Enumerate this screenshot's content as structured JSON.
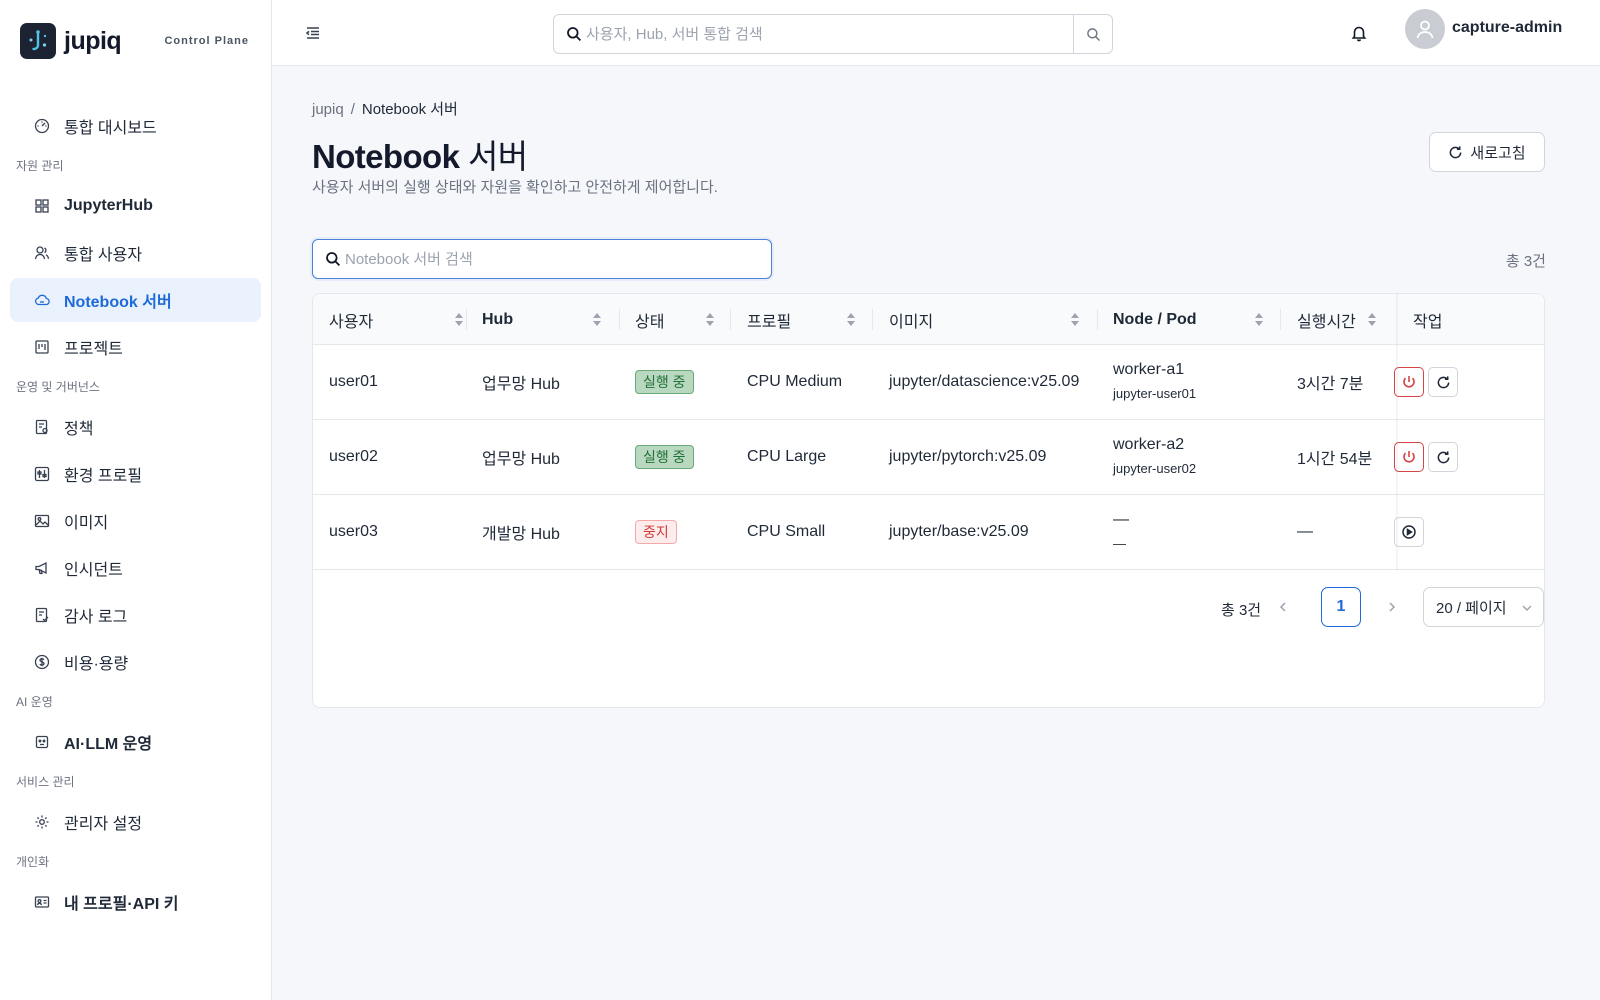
{
  "brand": {
    "name": "jupiq",
    "subtitle": "Control Plane"
  },
  "sidebar": {
    "items": [
      {
        "label": "통합 대시보드",
        "icon": "dashboard-icon"
      }
    ],
    "sections": [
      {
        "title": "자원 관리",
        "items": [
          {
            "label": "JupyterHub",
            "icon": "grid-icon"
          },
          {
            "label": "통합 사용자",
            "icon": "users-icon"
          },
          {
            "label": "Notebook 서버",
            "icon": "cloud-icon",
            "active": true
          },
          {
            "label": "프로젝트",
            "icon": "project-icon"
          }
        ]
      },
      {
        "title": "운영 및 거버넌스",
        "items": [
          {
            "label": "정책",
            "icon": "policy-icon"
          },
          {
            "label": "환경 프로필",
            "icon": "sliders-icon"
          },
          {
            "label": "이미지",
            "icon": "image-icon"
          },
          {
            "label": "인시던트",
            "icon": "megaphone-icon"
          },
          {
            "label": "감사 로그",
            "icon": "audit-icon"
          },
          {
            "label": "비용·용량",
            "icon": "dollar-icon"
          }
        ]
      },
      {
        "title": "AI 운영",
        "items": [
          {
            "label": "AI·LLM 운영",
            "icon": "robot-icon"
          }
        ]
      },
      {
        "title": "서비스 관리",
        "items": [
          {
            "label": "관리자 설정",
            "icon": "gear-icon"
          }
        ]
      },
      {
        "title": "개인화",
        "items": [
          {
            "label": "내 프로필·API 키",
            "icon": "id-card-icon"
          }
        ]
      }
    ]
  },
  "header": {
    "search_placeholder": "사용자, Hub, 서버 통합 검색",
    "username": "capture-admin"
  },
  "breadcrumb": {
    "root": "jupiq",
    "sep": "/",
    "current": "Notebook 서버"
  },
  "page": {
    "title_en": "Notebook",
    "title_ko": "서버",
    "subtitle": "사용자 서버의 실행 상태와 자원을 확인하고 안전하게 제어합니다.",
    "refresh_label": "새로고침",
    "search_placeholder": "Notebook 서버 검색",
    "total_label": "총 3건"
  },
  "table": {
    "headers": [
      "사용자",
      "Hub",
      "상태",
      "프로필",
      "이미지",
      "Node / Pod",
      "실행시간",
      "작업"
    ],
    "rows": [
      {
        "user": "user01",
        "hub": "업무망 Hub",
        "status": "실행 중",
        "status_kind": "running",
        "profile": "CPU Medium",
        "image": "jupyter/datascience:v25.09",
        "node": "worker-a1",
        "pod": "jupyter-user01",
        "runtime": "3시간 7분"
      },
      {
        "user": "user02",
        "hub": "업무망 Hub",
        "status": "실행 중",
        "status_kind": "running",
        "profile": "CPU Large",
        "image": "jupyter/pytorch:v25.09",
        "node": "worker-a2",
        "pod": "jupyter-user02",
        "runtime": "1시간 54분"
      },
      {
        "user": "user03",
        "hub": "개발망 Hub",
        "status": "중지",
        "status_kind": "stopped",
        "profile": "CPU Small",
        "image": "jupyter/base:v25.09",
        "node": "—",
        "pod": "—",
        "runtime": "—"
      }
    ]
  },
  "pagination": {
    "total_label": "총 3건",
    "current_page": "1",
    "page_size": "20 / 페이지"
  },
  "colors": {
    "accent": "#1d6ad8",
    "danger": "#d64545",
    "running": "#22703a",
    "stopped": "#d33b3b"
  }
}
